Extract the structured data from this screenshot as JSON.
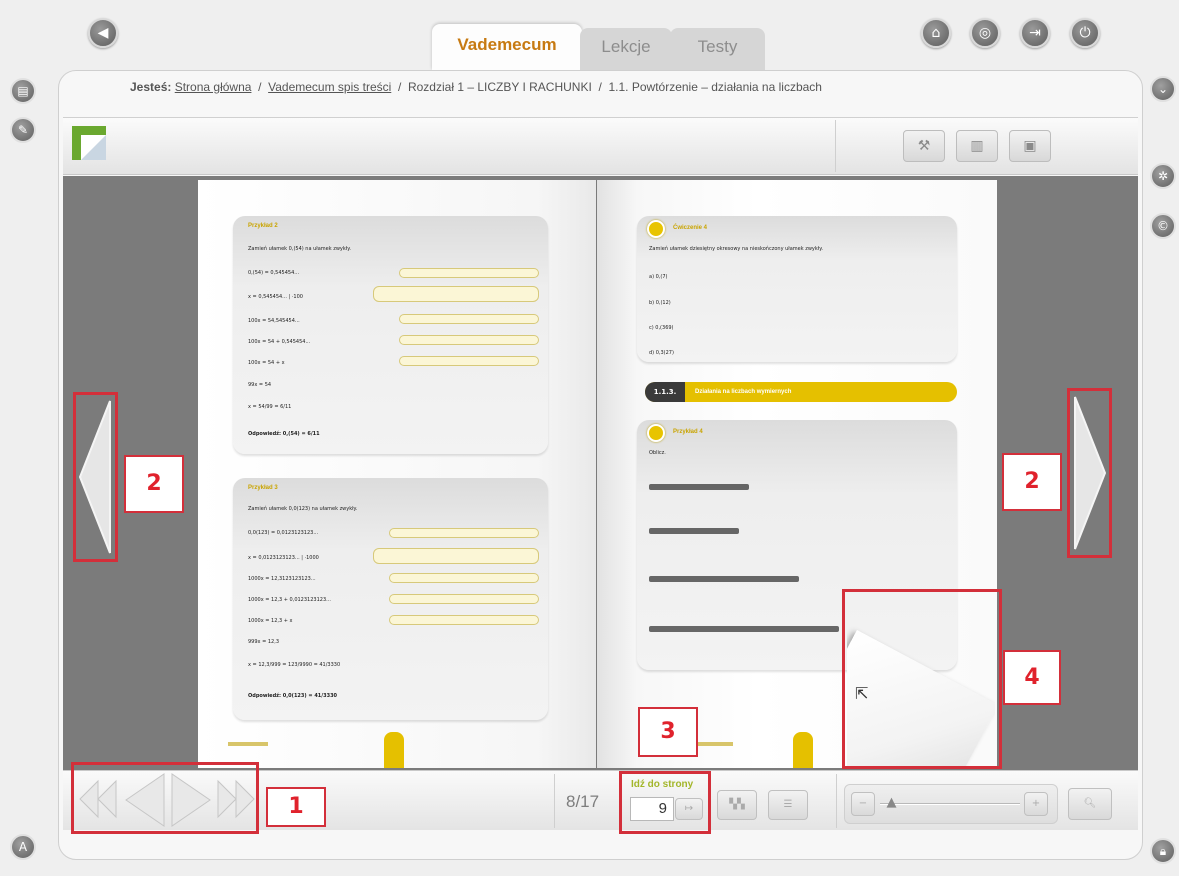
{
  "tabs": [
    {
      "label": "Vademecum",
      "active": true
    },
    {
      "label": "Lekcje",
      "active": false
    },
    {
      "label": "Testy",
      "active": false
    }
  ],
  "breadcrumb": {
    "prefix": "Jesteś:",
    "items": [
      "Strona główna",
      "Vademecum spis treści",
      "Rozdział 1 – LICZBY I RACHUNKI",
      "1.1. Powtórzenie – działania na liczbach"
    ],
    "separator": "/"
  },
  "icons": {
    "back": "back-arrow-icon",
    "top_right": [
      "home-icon",
      "lifebuoy-icon",
      "exit-icon",
      "power-icon"
    ],
    "left_side": [
      "notes-icon",
      "edit-icon"
    ],
    "right_side": [
      "collapse-icon",
      "settings-fan-icon",
      "copyright-icon"
    ],
    "bottom_left": "user-a-icon",
    "bottom_right": "lock-icon",
    "toolbar": [
      "tools-icon",
      "print-icon",
      "save-icon"
    ]
  },
  "colors": {
    "accent_tab": "#c77a12",
    "highlight_yellow": "#e5c000",
    "annotation_red": "#d32f3a"
  },
  "book": {
    "left_page": {
      "box1_title": "Przykład 2",
      "box1_task": "Zamień ułamek 0,(54) na ułamek zwykły.",
      "box1_lines": [
        "0,(54) = 0,545454...",
        "x = 0,545454... | ·100",
        "100x = 54,545454...",
        "100x = 54 + 0,545454...",
        "100x = 54 + x",
        "99x = 54",
        "x = 54/99 = 6/11"
      ],
      "box1_answer": "Odpowiedź: 0,(54) = 6/11",
      "box2_title": "Przykład 3",
      "box2_task": "Zamień ułamek 0,0(123) na ułamek zwykły.",
      "box2_lines": [
        "0,0(123) = 0,0123123123...",
        "x = 0,0123123123... | ·1000",
        "1000x = 12,3123123123...",
        "1000x = 12,3 + 0,0123123123...",
        "1000x = 12,3 + x",
        "999x = 12,3",
        "x = 12,3/999 = 123/9990 = 41/3330"
      ],
      "box2_answer": "Odpowiedź: 0,0(123) = 41/3330"
    },
    "right_page": {
      "exercise_title": "Ćwiczenie 4",
      "exercise_task": "Zamień ułamek dziesiętny okresowy na nieskończony ułamek zwykły.",
      "exercise_items": [
        "a) 0,(7)",
        "b) 0,(12)",
        "c) 0,(369)",
        "d) 0,3(27)"
      ],
      "section_number": "1.1.3.",
      "section_title": "Działania na liczbach wymiernych",
      "example_title": "Przykład 4",
      "example_task": "Oblicz."
    }
  },
  "annotations": [
    "1",
    "2",
    "2",
    "3",
    "4"
  ],
  "bottom": {
    "page_indicator": "8/17",
    "goto_label": "Idź do strony",
    "goto_value": "9",
    "zoom_level": 0.05
  }
}
